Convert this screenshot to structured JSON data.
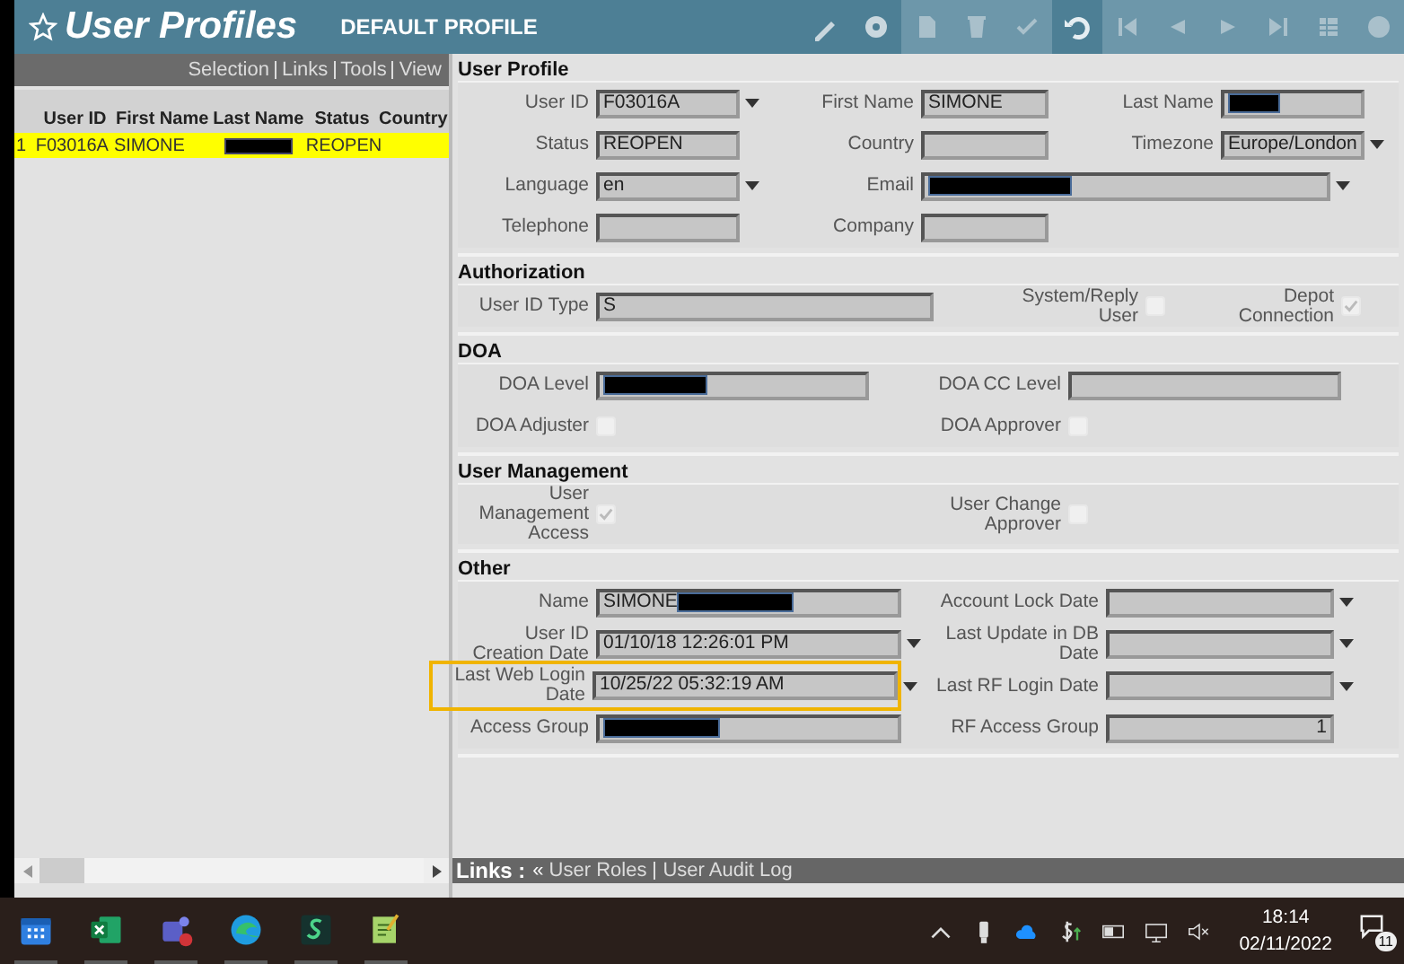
{
  "window": {
    "title": "User Profiles",
    "subtitle": "DEFAULT PROFILE"
  },
  "left_panel": {
    "menu": [
      "Selection",
      "Links",
      "Tools",
      "View"
    ],
    "table": {
      "columns": [
        "User ID",
        "First Name",
        "Last Name",
        "Status",
        "Country"
      ],
      "rows": [
        {
          "index": "1",
          "cells": [
            {
              "text": "F03016A"
            },
            {
              "text": "SIMONE"
            },
            {
              "text": "",
              "redacted": true
            },
            {
              "text": "REOPEN"
            },
            {}
          ],
          "selected": true
        }
      ]
    }
  },
  "sections": [
    {
      "kind": "profile",
      "title": "User Profile",
      "rows": [
        [
          {
            "kind": "combo",
            "label": "User ID",
            "value": "F03016A"
          },
          {
            "kind": "text",
            "label": "First Name",
            "value": "SIMONE"
          },
          {
            "kind": "text",
            "label": "Last Name",
            "redacted": true
          }
        ],
        [
          {
            "kind": "text",
            "label": "Status",
            "value": "REOPEN"
          },
          {
            "kind": "text",
            "label": "Country"
          },
          {
            "kind": "combo",
            "label": "Timezone",
            "value": "Europe/London"
          }
        ],
        [
          {
            "kind": "combo",
            "label": "Language",
            "value": "en"
          },
          {
            "kind": "wide_combo",
            "label": "Email",
            "redacted": true
          }
        ],
        [
          {
            "kind": "text",
            "label": "Telephone"
          },
          {
            "kind": "text",
            "label": "Company"
          }
        ]
      ]
    },
    {
      "kind": "authorization",
      "title": "Authorization",
      "rows": [
        [
          {
            "kind": "text",
            "label": "User ID Type",
            "value": "S"
          },
          {
            "kind": "checkbox",
            "label": "System/Reply User",
            "checked": false
          },
          {
            "kind": "checkbox",
            "label": "Depot Connection",
            "checked": true
          }
        ]
      ]
    },
    {
      "kind": "doa",
      "title": "DOA",
      "rows": [
        [
          {
            "kind": "text",
            "label": "DOA Level",
            "redacted": true
          },
          {
            "kind": "text",
            "label": "DOA CC Level"
          }
        ],
        [
          {
            "kind": "checkbox",
            "label": "DOA Adjuster",
            "checked": false
          },
          {
            "kind": "checkbox",
            "label": "DOA Approver",
            "checked": false
          }
        ]
      ]
    },
    {
      "kind": "doa",
      "title": "User Management",
      "rows": [
        [
          {
            "kind": "checkbox",
            "label": "User Management Access",
            "checked": true
          },
          {
            "kind": "checkbox",
            "label": "User Change Approver",
            "checked": false
          }
        ]
      ]
    },
    {
      "kind": "other",
      "title": "Other",
      "rows": [
        [
          {
            "kind": "text",
            "label": "Name",
            "value": "SIMONE",
            "redacted": true
          },
          {
            "kind": "combo",
            "label": "Account Lock Date"
          }
        ],
        [
          {
            "kind": "combo",
            "label": "User ID Creation Date",
            "value": "01/10/18 12:26:01 PM"
          },
          {
            "kind": "combo",
            "label": "Last Update in DB Date"
          }
        ],
        [
          {
            "kind": "combo",
            "label": "Last Web Login Date",
            "value": "10/25/22 05:32:19 AM",
            "highlighted": true
          },
          {
            "kind": "combo",
            "label": "Last RF Login Date"
          }
        ],
        [
          {
            "kind": "text",
            "label": "Access Group",
            "redacted": true
          },
          {
            "kind": "number",
            "label": "RF Access Group",
            "value": "1"
          }
        ]
      ]
    }
  ],
  "links_bar": {
    "title": "Links :",
    "arrow": "«",
    "links": [
      "User Roles",
      "User Audit Log"
    ]
  },
  "taskbar": {
    "time": "18:14",
    "date": "02/11/2022",
    "notifications": "11"
  }
}
